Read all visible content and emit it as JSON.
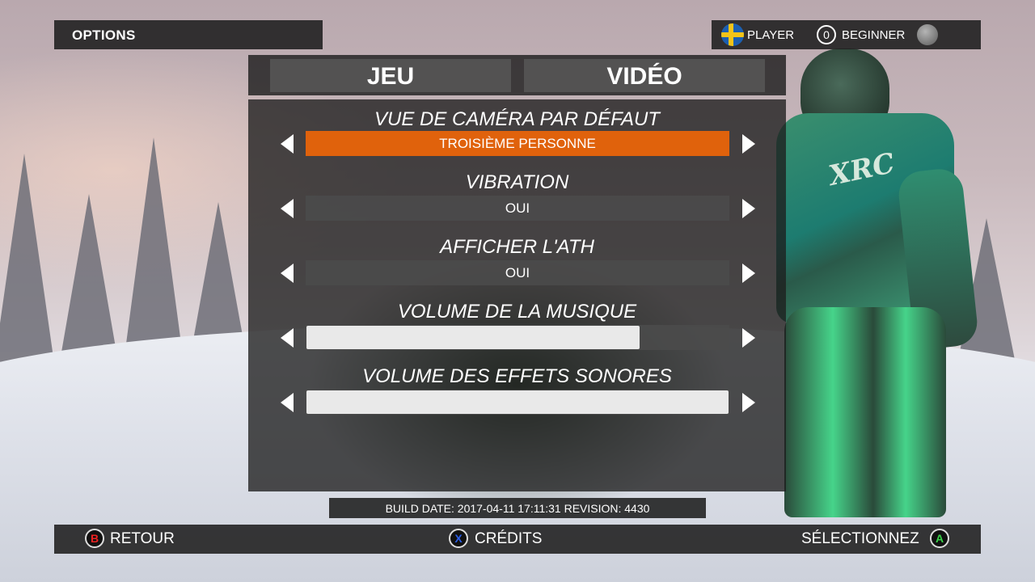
{
  "header": {
    "title": "OPTIONS",
    "player": {
      "name": "PLAYER",
      "level": "0",
      "rank": "BEGINNER"
    }
  },
  "tabs": [
    {
      "label": "JEU",
      "active": true
    },
    {
      "label": "VIDÉO",
      "active": false
    }
  ],
  "options": [
    {
      "label": "VUE DE CAMÉRA PAR DÉFAUT",
      "value": "TROISIÈME PERSONNE",
      "selected": true
    },
    {
      "label": "VIBRATION",
      "value": "OUI"
    },
    {
      "label": "AFFICHER L'ATH",
      "value": "OUI"
    },
    {
      "label": "VOLUME DE LA MUSIQUE",
      "slider_level": 0.79
    },
    {
      "label": "VOLUME DES EFFETS SONORES",
      "slider_level": 1.0
    }
  ],
  "build_info": "BUILD DATE: 2017-04-11 17:11:31   REVISION: 4430",
  "footer": {
    "back": {
      "glyph": "B",
      "label": "RETOUR"
    },
    "credits": {
      "glyph": "X",
      "label": "CRÉDITS"
    },
    "select": {
      "glyph": "A",
      "label": "SÉLECTIONNEZ"
    }
  },
  "colors": {
    "selection": "#e0620c",
    "panel": "#1e1e1e",
    "button_b": "#e22222",
    "button_x": "#2c5fe8",
    "button_a": "#3bd44a"
  }
}
